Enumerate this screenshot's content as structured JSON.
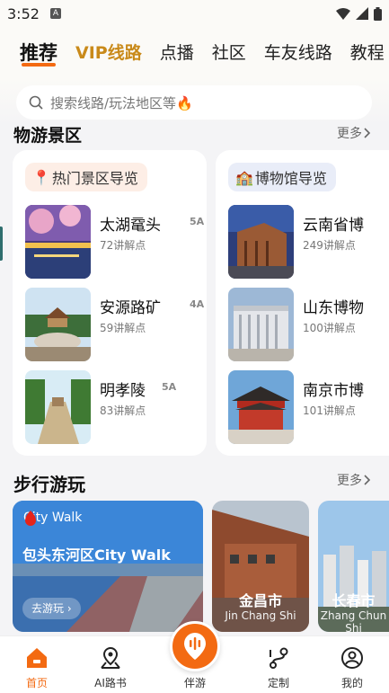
{
  "status_bar": {
    "time": "3:52",
    "sim_badge": "A"
  },
  "tabs": [
    {
      "label": "推荐",
      "active": true
    },
    {
      "label": "VIP线路",
      "vip": true
    },
    {
      "label": "点播"
    },
    {
      "label": "社区"
    },
    {
      "label": "车友线路"
    },
    {
      "label": "教程"
    }
  ],
  "search": {
    "placeholder": "搜索线路/玩法地区等🔥"
  },
  "scenic": {
    "title": "物游景区",
    "more_label": "更多",
    "cards": [
      {
        "header": "热门景区导览",
        "items": [
          {
            "name": "太湖鼋头",
            "level": "5A",
            "count": "72讲解点"
          },
          {
            "name": "安源路矿",
            "level": "4A",
            "count": "59讲解点"
          },
          {
            "name": "明孝陵",
            "level": "5A",
            "count": "83讲解点"
          }
        ]
      },
      {
        "header": "博物馆导览",
        "items": [
          {
            "name": "云南省博",
            "count": "249讲解点"
          },
          {
            "name": "山东博物",
            "count": "100讲解点"
          },
          {
            "name": "南京市博",
            "count": "101讲解点"
          }
        ]
      }
    ]
  },
  "walk": {
    "title": "步行游玩",
    "more_label": "更多",
    "feature": {
      "badge": "City Walk",
      "title": "包头东河区City Walk",
      "button": "去游玩"
    },
    "cities": [
      {
        "name": "金昌市",
        "pinyin": "Jin Chang Shi"
      },
      {
        "name": "长春市",
        "pinyin": "Zhang Chun Shi"
      }
    ]
  },
  "bottom_nav": [
    {
      "label": "首页",
      "active": true
    },
    {
      "label": "AI路书"
    },
    {
      "label": "伴游"
    },
    {
      "label": "定制"
    },
    {
      "label": "我的"
    }
  ],
  "colors": {
    "accent": "#f36a12",
    "vip": "#c98a1a",
    "background": "#f4f4f6"
  }
}
